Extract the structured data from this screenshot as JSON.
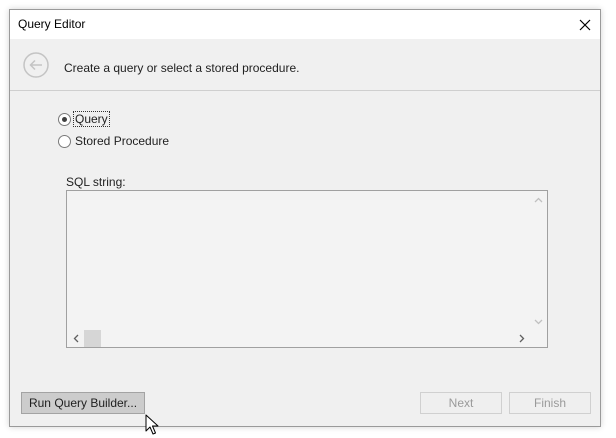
{
  "window": {
    "title": "Query Editor"
  },
  "header": {
    "instruction": "Create a query or select a stored procedure."
  },
  "options": {
    "query_label": "Query",
    "stored_procedure_label": "Stored Procedure",
    "selected": "Query"
  },
  "sql": {
    "label": "SQL string:",
    "value": ""
  },
  "buttons": {
    "run_query_builder": "Run Query Builder...",
    "next": "Next",
    "finish": "Finish"
  },
  "icons": {
    "close": "close-icon",
    "back": "back-arrow-icon",
    "cursor": "mouse-pointer-icon"
  },
  "colors": {
    "disabled_text": "#9a9a9a",
    "window_bg": "#f0f0f0"
  }
}
